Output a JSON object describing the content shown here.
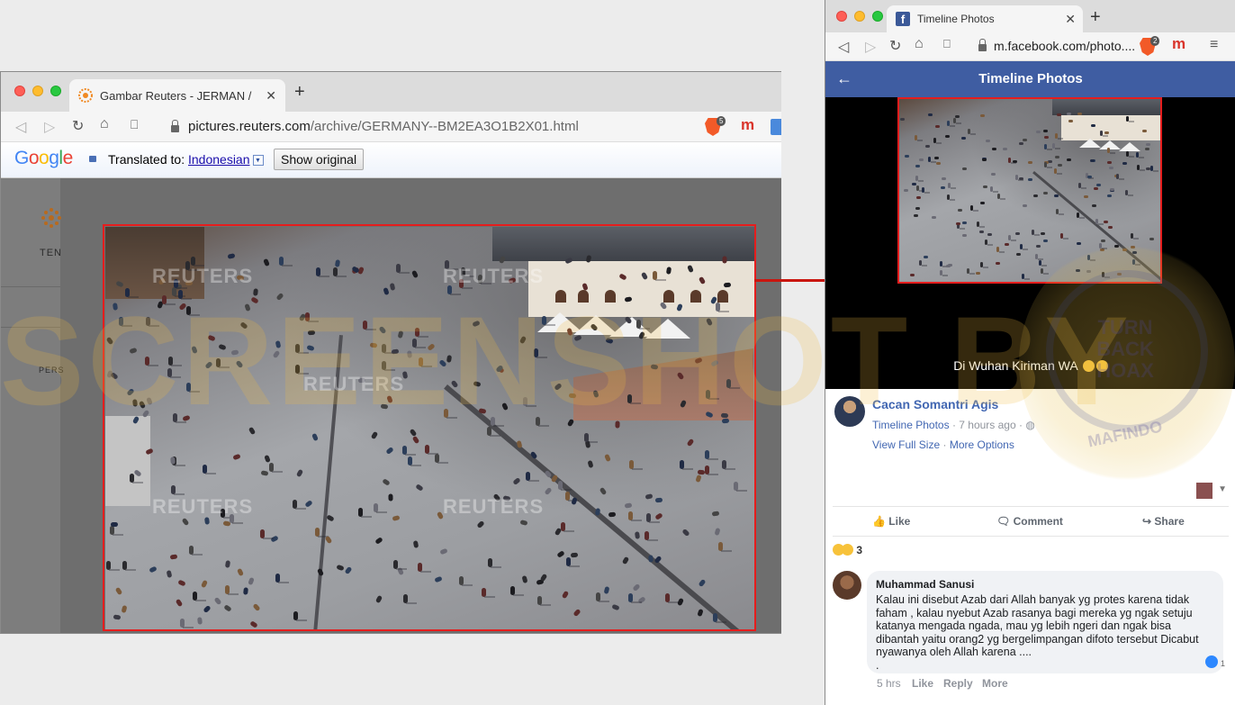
{
  "left_window": {
    "tab_title": "Gambar Reuters - JERMAN /",
    "new_tab": "+",
    "url_host": "pictures.reuters.com",
    "url_path": "/archive/GERMANY--BM2EA3O1B2X01.html",
    "brave_badge": "5",
    "translate_bar": {
      "logo": "Google",
      "translated_to_label": "Translated to:",
      "language": "Indonesian",
      "show_original": "Show original"
    },
    "side_logo_text": "TEN",
    "side_item": "PERS",
    "photo_watermark": "REUTERS"
  },
  "right_window": {
    "tab_title": "Timeline Photos",
    "new_tab": "+",
    "url": "m.facebook.com/photo....",
    "brave_badge": "2",
    "header_title": "Timeline Photos",
    "caption": "Di Wuhan Kiriman WA",
    "post": {
      "author": "Cacan Somantri Agis",
      "album": "Timeline Photos",
      "time": "· 7 hours ago ·",
      "view_full_size": "View Full Size",
      "more_options": "More Options",
      "separator": "·"
    },
    "actions": {
      "like": "Like",
      "comment": "Comment",
      "share": "Share"
    },
    "reaction_count": "3",
    "comment": {
      "author": "Muhammad Sanusi",
      "text": "Kalau ini disebut Azab dari Allah banyak yg protes karena tidak faham , kalau nyebut Azab rasanya bagi mereka yg ngak setuju katanya mengada ngada, mau yg lebih ngeri dan ngak bisa dibantah yaitu orang2 yg bergelimpangan difoto tersebut Dicabut nyawanya oleh Allah karena ....\n.",
      "like_count": "1",
      "time": "5 hrs",
      "like": "Like",
      "reply": "Reply",
      "more": "More"
    }
  },
  "overlay": {
    "big_text": "SCREENSHOT BY",
    "seal_line1": "TURN",
    "seal_line2": "BACK",
    "seal_line3": "HOAX",
    "seal_bottom": "MAFINDO"
  },
  "colors": {
    "highlight_red": "#e51d1d",
    "facebook_blue": "#3f5da2",
    "link_blue": "#4267b2"
  }
}
